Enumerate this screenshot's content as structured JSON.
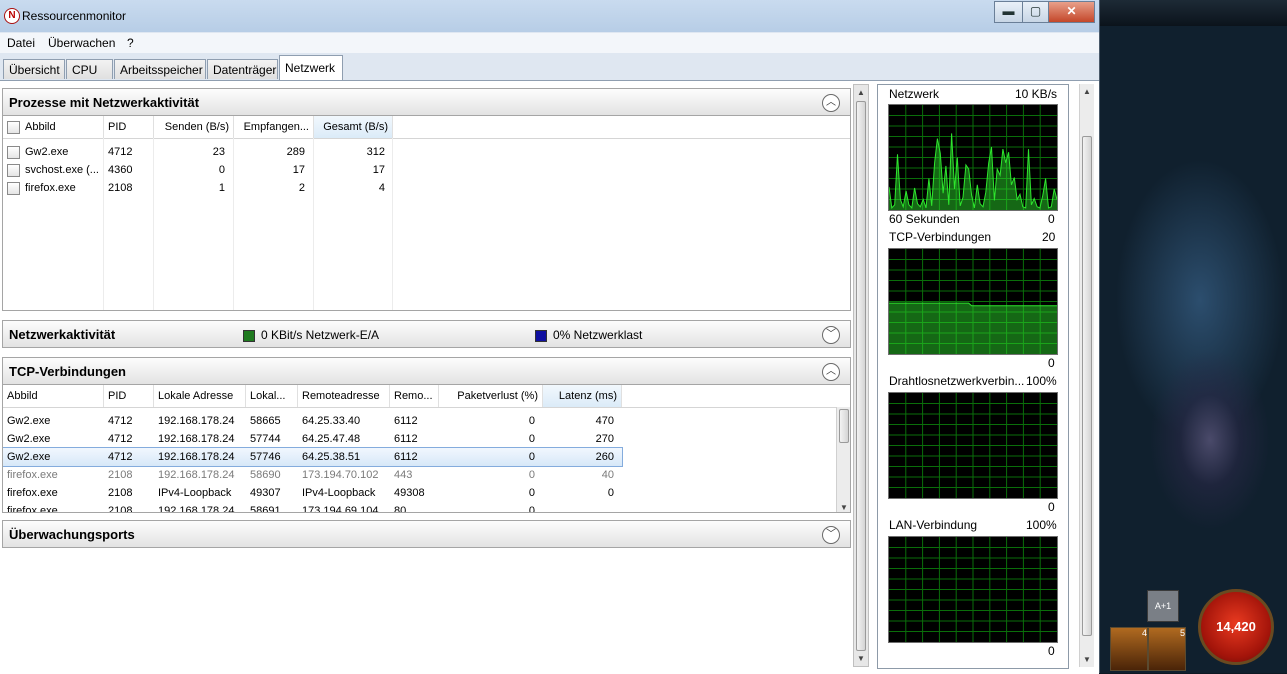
{
  "window": {
    "title": "Ressourcenmonitor",
    "app_icon": "resource-monitor-icon",
    "controls": {
      "minimize": "▬",
      "maximize": "▢",
      "close": "✕"
    }
  },
  "menu": [
    "Datei",
    "Überwachen",
    "?"
  ],
  "tabs": [
    "Übersicht",
    "CPU",
    "Arbeitsspeicher",
    "Datenträger",
    "Netzwerk"
  ],
  "active_tab": "Netzwerk",
  "processes": {
    "title": "Prozesse mit Netzwerkaktivität",
    "columns": [
      "Abbild",
      "PID",
      "Senden (B/s)",
      "Empfangen...",
      "Gesamt (B/s)"
    ],
    "sorted_column": "Gesamt (B/s)",
    "rows": [
      {
        "image": "Gw2.exe",
        "pid": "4712",
        "send": "23",
        "recv": "289",
        "total": "312"
      },
      {
        "image": "svchost.exe (...",
        "pid": "4360",
        "send": "0",
        "recv": "17",
        "total": "17"
      },
      {
        "image": "firefox.exe",
        "pid": "2108",
        "send": "1",
        "recv": "2",
        "total": "4"
      }
    ]
  },
  "network_activity": {
    "title": "Netzwerkaktivität",
    "io": "0 KBit/s Netzwerk-E/A",
    "io_color": "#1f7a1f",
    "load": "0% Netzwerklast",
    "load_color": "#1010a0"
  },
  "tcp": {
    "title": "TCP-Verbindungen",
    "columns": [
      "Abbild",
      "PID",
      "Lokale Adresse",
      "Lokal...",
      "Remoteadresse",
      "Remo...",
      "Paketverlust (%)",
      "Latenz (ms)"
    ],
    "sorted_column": "Latenz (ms)",
    "rows": [
      {
        "image": "Gw2.exe",
        "pid": "4712",
        "laddr": "192.168.178.24",
        "lport": "58665",
        "raddr": "64.25.33.40",
        "rport": "6112",
        "loss": "0",
        "lat": "470"
      },
      {
        "image": "Gw2.exe",
        "pid": "4712",
        "laddr": "192.168.178.24",
        "lport": "57744",
        "raddr": "64.25.47.48",
        "rport": "6112",
        "loss": "0",
        "lat": "270"
      },
      {
        "image": "Gw2.exe",
        "pid": "4712",
        "laddr": "192.168.178.24",
        "lport": "57746",
        "raddr": "64.25.38.51",
        "rport": "6112",
        "loss": "0",
        "lat": "260"
      },
      {
        "image": "firefox.exe",
        "pid": "2108",
        "laddr": "192.168.178.24",
        "lport": "58690",
        "raddr": "173.194.70.102",
        "rport": "443",
        "loss": "0",
        "lat": "40"
      },
      {
        "image": "firefox.exe",
        "pid": "2108",
        "laddr": "IPv4-Loopback",
        "lport": "49307",
        "raddr": "IPv4-Loopback",
        "rport": "49308",
        "loss": "0",
        "lat": "0"
      },
      {
        "image": "firefox.exe",
        "pid": "2108",
        "laddr": "192.168.178.24",
        "lport": "58691",
        "raddr": "173.194.69.104",
        "rport": "80",
        "loss": "0",
        "lat": ""
      }
    ]
  },
  "monitor_ports": {
    "title": "Überwachungsports"
  },
  "charts": {
    "network": {
      "label": "Netzwerk",
      "max": "10 KB/s",
      "x_label": "60 Sekunden",
      "min": "0"
    },
    "tcp": {
      "label": "TCP-Verbindungen",
      "max": "20",
      "min": "0"
    },
    "wireless": {
      "label": "Drahtlosnetzwerkverbin...",
      "max": "100%",
      "min": "0"
    },
    "lan": {
      "label": "LAN-Verbindung",
      "max": "100%",
      "min": "0"
    },
    "line_color": "#2ee62e",
    "grid_color": "#0a6e0a"
  },
  "game_hud": {
    "health": "14,420",
    "skill_a": "A+1",
    "skill_counts": [
      "4",
      "5"
    ]
  },
  "chart_data": [
    {
      "type": "area",
      "title": "Netzwerk",
      "ylabel": "10 KB/s",
      "xlabel": "60 Sekunden",
      "ylim": [
        0,
        10
      ],
      "values": [
        2.2,
        0.2,
        0.5,
        5.3,
        1.0,
        0.3,
        1.8,
        0.5,
        0.2,
        2.1,
        0.6,
        0.3,
        1.0,
        0.2,
        3.0,
        0.4,
        4.5,
        6.8,
        5.4,
        1.6,
        4.2,
        0.5,
        7.3,
        2.0,
        5.0,
        0.4,
        1.2,
        4.3,
        3.9,
        1.4,
        0.2,
        2.4,
        0.6,
        0.3,
        1.7,
        4.5,
        6.0,
        0.9,
        3.9,
        3.3,
        5.8,
        4.5,
        5.5,
        2.4,
        3.1,
        1.0,
        1.5,
        0.3,
        0.2,
        5.8,
        0.5,
        1.1,
        0.3,
        0.2,
        1.4,
        3.0,
        0.2,
        0.3,
        2.0,
        1.0
      ]
    },
    {
      "type": "area",
      "title": "TCP-Verbindungen",
      "ylabel": "20",
      "ylim": [
        0,
        20
      ],
      "values": [
        9.7,
        9.7,
        9.7,
        9.7,
        9.7,
        9.7,
        9.7,
        9.7,
        9.7,
        9.7,
        9.7,
        9.7,
        9.7,
        9.7,
        9.7,
        9.7,
        9.7,
        9.7,
        9.7,
        9.7,
        9.7,
        9.7,
        9.7,
        9.7,
        9.7,
        9.7,
        9.7,
        9.7,
        9.7,
        9.2,
        9.2,
        9.2,
        9.2,
        9.2,
        9.2,
        9.2,
        9.2,
        9.2,
        9.2,
        9.2,
        9.2,
        9.2,
        9.2,
        9.2,
        9.2,
        9.2,
        9.2,
        9.2,
        9.2,
        9.2,
        9.2,
        9.2,
        9.2,
        9.2,
        9.2,
        9.2,
        9.2,
        9.2,
        9.2,
        9.2
      ]
    }
  ]
}
